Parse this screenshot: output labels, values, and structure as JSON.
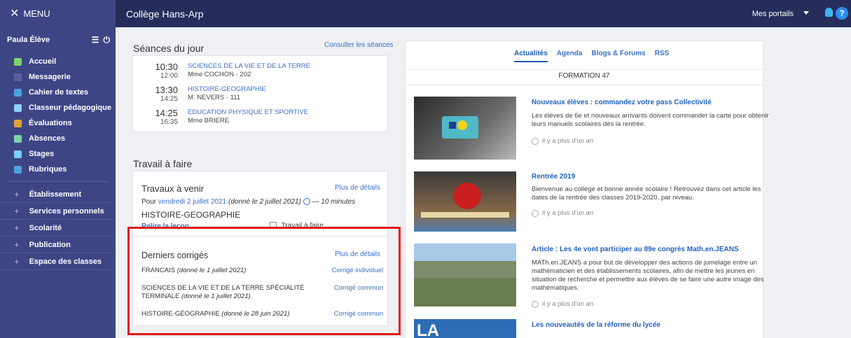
{
  "topbar": {
    "menu_label": "MENU",
    "school": "Collège Hans-Arp",
    "portals": "Mes portails",
    "help": "?"
  },
  "sidebar": {
    "user": "Paula Élève",
    "nav": [
      {
        "label": "Accueil",
        "icon": "home-icon",
        "color": "#7ed36b"
      },
      {
        "label": "Messagerie",
        "icon": "envelope-icon",
        "color": "#5b609e"
      },
      {
        "label": "Cahier de textes",
        "icon": "notebook-icon",
        "color": "#4aa3df"
      },
      {
        "label": "Classeur pédagogique",
        "icon": "binder-icon",
        "color": "#8fd0f5"
      },
      {
        "label": "Évaluations",
        "icon": "chart-icon",
        "color": "#e0a33a"
      },
      {
        "label": "Absences",
        "icon": "person-icon",
        "color": "#7fd0a8"
      },
      {
        "label": "Stages",
        "icon": "compass-icon",
        "color": "#7ad0f7"
      },
      {
        "label": "Rubriques",
        "icon": "comment-icon",
        "color": "#4aa3df"
      }
    ],
    "sections": [
      "Établissement",
      "Services personnels",
      "Scolarité",
      "Publication",
      "Espace des classes"
    ]
  },
  "seances": {
    "title": "Séances du jour",
    "link": "Consulter les séances",
    "rows": [
      {
        "start": "10:30",
        "end": "12:00",
        "subject": "SCIENCES DE LA VIE ET DE LA TERRE",
        "teacher": "Mme COCHON - 202"
      },
      {
        "start": "13:30",
        "end": "14:25",
        "subject": "HISTOIRE-GEOGRAPHIE",
        "teacher": "M. NEVERS - 111"
      },
      {
        "start": "14:25",
        "end": "16:35",
        "subject": "EDUCATION PHYSIQUE ET SPORTIVE",
        "teacher": "Mme BRIERE"
      }
    ]
  },
  "travail": {
    "title": "Travail à faire",
    "subtitle": "Travaux à venir",
    "details": "Plus de détails",
    "pour": "Pour",
    "date": "vendredi 2 juillet 2021",
    "given": "(donné le 2 juillet 2021)",
    "duration": "— 10 minutes",
    "subject": "HISTOIRE-GEOGRAPHIE",
    "task": "Relire la leçon",
    "checkbox": "Travail à faire"
  },
  "corriges": {
    "title": "Derniers corrigés",
    "details": "Plus de détails",
    "rows": [
      {
        "subject": "FRANCAIS",
        "given": "(donné le 1 juillet 2021)",
        "type": "Corrigé individuel"
      },
      {
        "subject": "SCIENCES DE LA VIE ET DE LA TERRE SPÉCIALITÉ TERMINALE",
        "given": "(donné le 1 juillet 2021)",
        "type": "Corrigé commun"
      },
      {
        "subject": "HISTOIRE-GÉOGRAPHIE",
        "given": "(donné le 28 juin 2021)",
        "type": "Corrigé commun"
      }
    ]
  },
  "news": {
    "tabs": [
      "Actualités",
      "Agenda",
      "Blogs & Forums",
      "RSS"
    ],
    "channel": "FORMATION 47",
    "items": [
      {
        "title": "Nouveaux élèves : commandez votre pass Collectivité",
        "text": "Les élèves de 6e et nouveaux arrivants doivent commander la carte pour obtenir leurs manuels scolaires dès la rentrée.",
        "time": "il y a plus d'un an"
      },
      {
        "title": "Rentrée 2019",
        "text": "Bienvenue au collège et bonne année scolaire ! Retrouvez dans cet article les dates de la rentrée des classes 2019-2020, par niveau.",
        "time": "il y a plus d'un an"
      },
      {
        "title": "Article : Les 4e vont participer au 89e congrès Math.en.JEANS",
        "text": "MATh.en.JEANS a pour but de développer des actions de jumelage entre un mathématicien et des établissements scolaires, afin de mettre les jeunes en situation de recherche et permettre aux élèves de se faire une autre image des mathématiques.",
        "time": "il y a plus d'un an"
      },
      {
        "title": "Les nouveautés de la réforme du lycée",
        "image_text": "LA RÉFORME"
      }
    ]
  }
}
